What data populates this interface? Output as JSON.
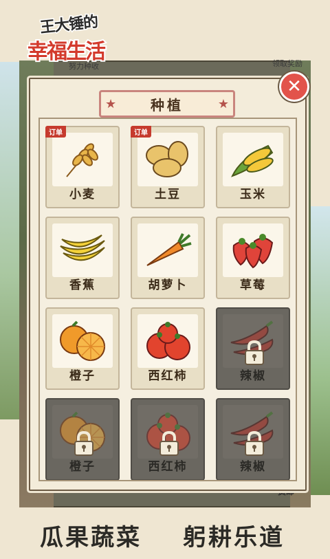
{
  "logo": {
    "line1": "王大锤的",
    "line2": "幸福生活"
  },
  "background": {
    "top_left_text": "努力种收",
    "top_right_text": "领取奖励",
    "bottom_right_text": "货邮"
  },
  "panel": {
    "title": "种植",
    "close_label": "✕"
  },
  "crops": [
    {
      "name": "小麦",
      "badge": "订单",
      "locked": false,
      "icon": "wheat-icon"
    },
    {
      "name": "土豆",
      "badge": "订单",
      "locked": false,
      "icon": "potato-icon"
    },
    {
      "name": "玉米",
      "badge": "",
      "locked": false,
      "icon": "corn-icon"
    },
    {
      "name": "香蕉",
      "badge": "",
      "locked": false,
      "icon": "banana-icon"
    },
    {
      "name": "胡萝卜",
      "badge": "",
      "locked": false,
      "icon": "carrot-icon"
    },
    {
      "name": "草莓",
      "badge": "",
      "locked": false,
      "icon": "strawberry-icon"
    },
    {
      "name": "橙子",
      "badge": "",
      "locked": false,
      "icon": "orange-icon"
    },
    {
      "name": "西红柿",
      "badge": "",
      "locked": false,
      "icon": "tomato-icon"
    },
    {
      "name": "辣椒",
      "badge": "",
      "locked": true,
      "icon": "chili-icon"
    },
    {
      "name": "橙子",
      "badge": "",
      "locked": true,
      "icon": "orange-icon"
    },
    {
      "name": "西红柿",
      "badge": "",
      "locked": true,
      "icon": "tomato-icon"
    },
    {
      "name": "辣椒",
      "badge": "",
      "locked": true,
      "icon": "chili-icon"
    }
  ],
  "slogan": {
    "left": "瓜果蔬菜",
    "right": "躬耕乐道"
  },
  "colors": {
    "accent_red": "#c63b2e",
    "close_red": "#e2534b",
    "panel_bg": "#f3ecda",
    "locked_gray": "#6a6760"
  }
}
